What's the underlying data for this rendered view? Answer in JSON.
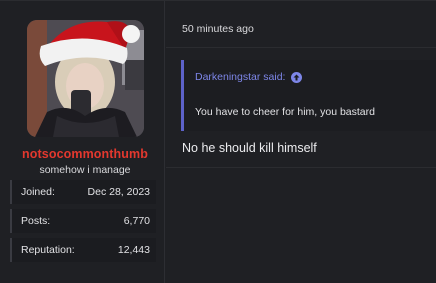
{
  "user": {
    "username": "notsocommonthumb",
    "title": "somehow i manage",
    "stats": [
      {
        "label": "Joined:",
        "value": "Dec 28, 2023"
      },
      {
        "label": "Posts:",
        "value": "6,770"
      },
      {
        "label": "Reputation:",
        "value": "12,443"
      }
    ]
  },
  "post": {
    "timestamp": "50 minutes ago",
    "quote": {
      "author_line": "Darkeningstar said:",
      "text": "You have to cheer for him, you bastard"
    },
    "message": "No he should kill himself"
  },
  "colors": {
    "background": "#1f2024",
    "username": "#e3382e",
    "quote_accent": "#7d86e8",
    "quote_border": "#5d62c9"
  },
  "icons": {
    "quote_jump": "arrow-up-circle-icon",
    "avatar_hat": "santa-hat-icon"
  }
}
